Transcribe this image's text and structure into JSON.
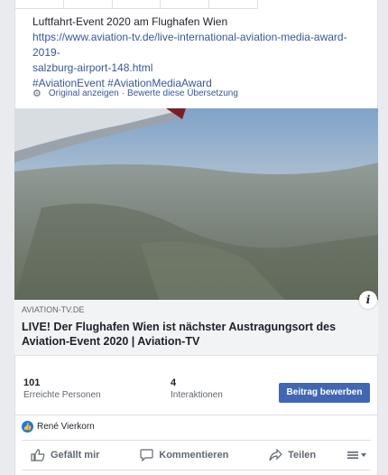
{
  "post": {
    "lines": [
      "Luftfahrt-Event 2020 am Flughafen Wien",
      "https://www.aviation-tv.de/live-international-aviation-media-award-2019-",
      "salzburg-airport-148.html",
      "#AviationEvent #AviationMediaAward"
    ],
    "see_original": "Original anzeigen",
    "separator": "·",
    "rate_translation": "Bewerte diese Übersetzung"
  },
  "link_preview": {
    "domain": "AVIATION-TV.DE",
    "title": "LIVE! Der Flughafen Wien ist nächster Austragungsort des Aviation-Event 2020 | Aviation-TV",
    "info_label": "i"
  },
  "stats": {
    "reach_value": "101",
    "reach_label": "Erreichte Personen",
    "interactions_value": "4",
    "interactions_label": "Interaktionen",
    "promote_label": "Beitrag bewerben"
  },
  "reaction": {
    "name": "René Vierkorn"
  },
  "actions": {
    "like": "Gefällt mir",
    "comment": "Kommentieren",
    "share": "Teilen"
  },
  "colors": {
    "link": "#385898",
    "primary_button": "#4267b2",
    "like_badge": "#1877f2"
  },
  "icons": [
    "gear-icon",
    "info-icon",
    "like-badge-icon",
    "thumbs-up-icon",
    "comment-icon",
    "share-icon",
    "audience-menu-icon"
  ]
}
